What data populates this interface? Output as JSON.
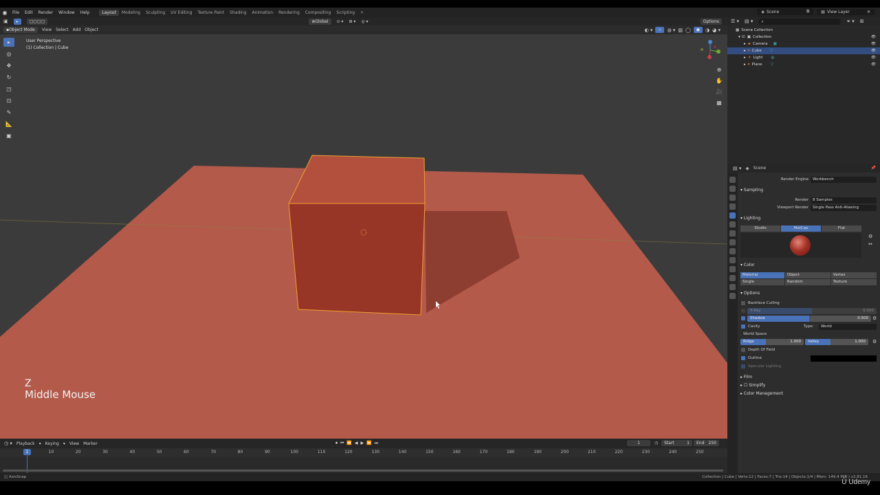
{
  "top_menu": {
    "items": [
      "File",
      "Edit",
      "Render",
      "Window",
      "Help"
    ],
    "workspaces": [
      "Layout",
      "Modeling",
      "Sculpting",
      "UV Editing",
      "Texture Paint",
      "Shading",
      "Animation",
      "Rendering",
      "Compositing",
      "Scripting"
    ],
    "active_workspace": "Layout",
    "add_tab": "+",
    "scene_label": "Scene",
    "view_layer_label": "View Layer"
  },
  "viewport_header": {
    "orientation": "Global",
    "options": "Options"
  },
  "viewport_header2": {
    "mode": "Object Mode",
    "menu": [
      "View",
      "Select",
      "Add",
      "Object"
    ]
  },
  "viewport": {
    "info_line1": "User Perspective",
    "info_line2": "(1) Collection | Cube",
    "keycast_key": "Z",
    "keycast_mouse": "Middle Mouse",
    "colors": {
      "background": "#3b3b3b",
      "plane": "#b85e4e",
      "cube": "#a2402c",
      "selection_outline": "#f0a030"
    }
  },
  "timeline": {
    "menu": [
      "Playback",
      "Keying",
      "View",
      "Marker"
    ],
    "current_frame": "1",
    "start_label": "Start",
    "start_value": "1",
    "end_label": "End",
    "end_value": "250",
    "ticks": [
      "1",
      "10",
      "20",
      "30",
      "40",
      "50",
      "60",
      "70",
      "80",
      "90",
      "100",
      "110",
      "120",
      "130",
      "140",
      "150",
      "160",
      "170",
      "180",
      "190",
      "200",
      "210",
      "220",
      "230",
      "240",
      "250"
    ]
  },
  "outliner": {
    "scene_collection": "Scene Collection",
    "collection": "Collection",
    "items": [
      {
        "name": "Camera",
        "selected": false,
        "icon": "camera-icon"
      },
      {
        "name": "Cube",
        "selected": true,
        "icon": "mesh-icon"
      },
      {
        "name": "Light",
        "selected": false,
        "icon": "light-icon"
      },
      {
        "name": "Plane",
        "selected": false,
        "icon": "mesh-icon"
      }
    ]
  },
  "properties": {
    "context": "Scene",
    "render_engine_label": "Render Engine",
    "render_engine_value": "Workbench",
    "sampling_title": "Sampling",
    "render_label": "Render",
    "render_value": "8 Samples",
    "viewport_render_label": "Viewport Render",
    "viewport_render_value": "Single Pass Anti-Aliasing",
    "lighting_title": "Lighting",
    "lighting_modes": [
      "Studio",
      "MatCap",
      "Flat"
    ],
    "lighting_active": "MatCap",
    "color_title": "Color",
    "color_options_row1": [
      "Material",
      "Object",
      "Vertex"
    ],
    "color_options_row2": [
      "Single",
      "Random",
      "Texture"
    ],
    "color_active": "Material",
    "options_title": "Options",
    "backface_culling": "Backface Culling",
    "xray_label": "X-Ray",
    "xray_value": "0.500",
    "shadow_label": "Shadow",
    "shadow_value": "0.500",
    "shadow_level": 0.5,
    "cavity_label": "Cavity",
    "cavity_type_label": "Type:",
    "cavity_type_value": "World",
    "world_space_label": "World Space",
    "ridge_label": "Ridge",
    "ridge_value": "1.000",
    "valley_label": "Valley",
    "valley_value": "1.000",
    "depth_of_field": "Depth Of Field",
    "outline": "Outline",
    "specular_lighting": "Specular Lighting",
    "film_title": "Film",
    "simplify_title": "Simplify",
    "color_management_title": "Color Management"
  },
  "statusbar": {
    "left": "AxisSnap",
    "right": "Collection | Cube | Verts:12 | Faces:7 | Tris:14 | Objects:1/4 | Mem: 149.4 MiB | v2.81.16"
  },
  "watermark": "Udemy"
}
